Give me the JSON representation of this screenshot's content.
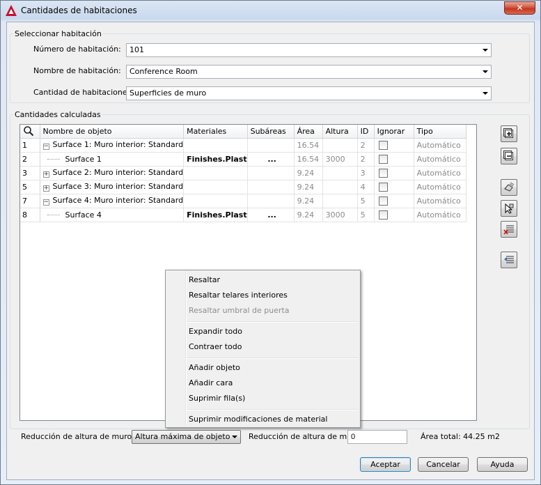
{
  "window": {
    "title": "Cantidades de habitaciones",
    "close_glyph": "✕"
  },
  "select_room": {
    "legend": "Seleccionar habitación",
    "number_label": "Número de habitación:",
    "number_value": "101",
    "name_label": "Nombre de habitación:",
    "name_value": "Conference Room",
    "quantity_label": "Cantidad de habitaciones:",
    "quantity_value": "Superficies de muro"
  },
  "calculated": {
    "legend": "Cantidades calculadas",
    "columns": [
      "Nombre de objeto",
      "Materiales",
      "Subáreas",
      "Área",
      "Altura",
      "ID",
      "Ignorar",
      "Tipo"
    ],
    "rows": [
      {
        "num": "1",
        "name": "Surface 1: Muro interior: Standard",
        "tree": "−",
        "level": 0,
        "material": "",
        "subareas": "",
        "area": "16.54",
        "height": "",
        "id": "2",
        "type": "Automático"
      },
      {
        "num": "2",
        "name": "Surface 1",
        "tree": "",
        "level": 1,
        "material": "Finishes.Plast",
        "subareas": "...",
        "area": "16.54",
        "height": "3000",
        "id": "2",
        "type": "Automático"
      },
      {
        "num": "3",
        "name": "Surface 2: Muro interior: Standard",
        "tree": "+",
        "level": 0,
        "material": "",
        "subareas": "",
        "area": "9.24",
        "height": "",
        "id": "3",
        "type": "Automático"
      },
      {
        "num": "5",
        "name": "Surface 3: Muro interior: Standard",
        "tree": "+",
        "level": 0,
        "material": "",
        "subareas": "",
        "area": "9.24",
        "height": "",
        "id": "4",
        "type": "Automático"
      },
      {
        "num": "7",
        "name": "Surface 4: Muro interior: Standard",
        "tree": "−",
        "level": 0,
        "material": "",
        "subareas": "",
        "area": "9.24",
        "height": "",
        "id": "5",
        "type": "Automático"
      },
      {
        "num": "8",
        "name": "Surface 4",
        "tree": "",
        "level": 1,
        "material": "Finishes.Plast",
        "subareas": "...",
        "area": "9.24",
        "height": "3000",
        "id": "5",
        "type": "Automático"
      }
    ]
  },
  "context_menu": {
    "items": [
      "Resaltar",
      "Resaltar telares interiores",
      "Resaltar umbral de puerta",
      "Expandir todo",
      "Contraer todo",
      "Añadir objeto",
      "Añadir cara",
      "Suprimir fila(s)",
      "Suprimir modificaciones de material"
    ]
  },
  "bottom": {
    "reduction_label": "Reducción de altura de muro de",
    "reduction_value": "Altura máxima de objeto",
    "reduction2_label": "Reducción de altura de muro",
    "reduction2_value": "0",
    "total_area": "Área total: 44.25 m2"
  },
  "buttons": {
    "accept": "Aceptar",
    "cancel": "Cancelar",
    "help": "Ayuda"
  },
  "side_toolbar_icons": [
    "expand-all-icon",
    "collapse-all-icon",
    "highlight-icon",
    "add-object-icon",
    "delete-rows-icon",
    "remove-overrides-icon"
  ],
  "colors": {
    "accent_red": "#c8102e",
    "muted_text": "#8a8a8a"
  }
}
